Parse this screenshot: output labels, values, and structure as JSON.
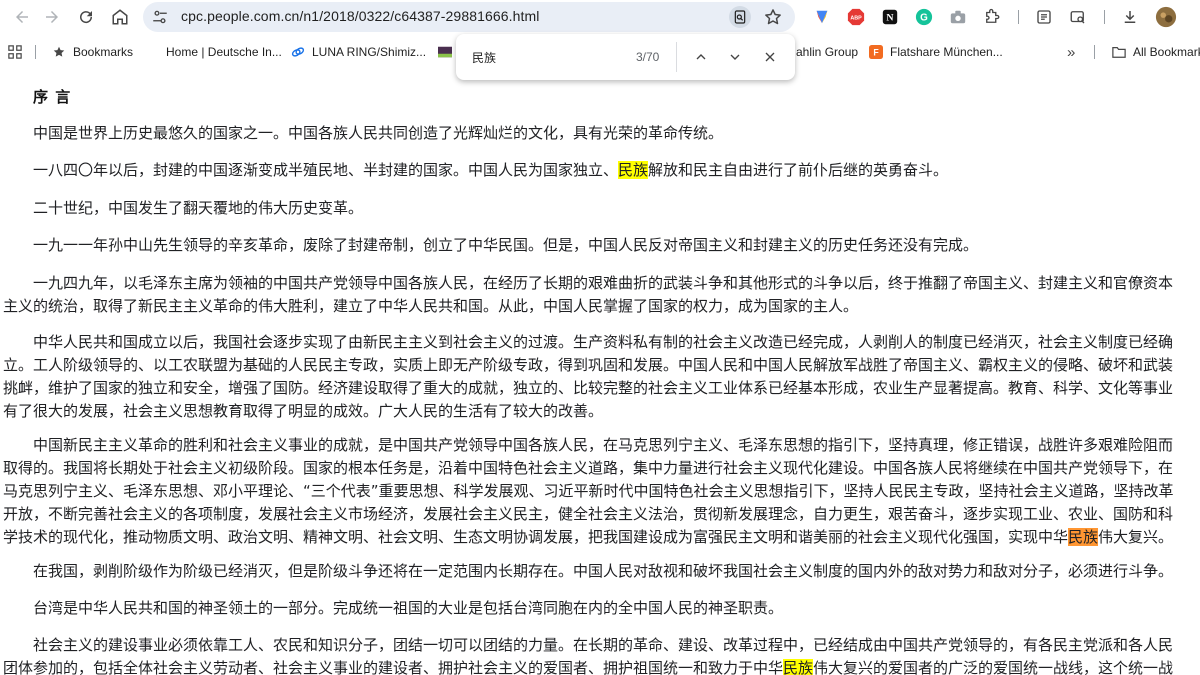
{
  "browser": {
    "url": "cpc.people.com.cn/n1/2018/0322/c64387-29881666.html"
  },
  "bookmarks": {
    "bookmarks_label": "Bookmarks",
    "item_home": "Home | Deutsche In...",
    "item_luna": "LUNA RING/Shimiz...",
    "item_dahlin": "ahlin Group",
    "item_flatshare": "Flatshare München...",
    "overflow": "»",
    "all_bookmarks": "All Bookmark"
  },
  "find": {
    "query": "民族",
    "count": "3/70"
  },
  "article": {
    "heading": "序 言",
    "p1": [
      "中国是世界上历史最悠久的国家之一。中国各族人民共同创造了光辉灿烂的文化，具有光荣的革命传统。"
    ],
    "p2_pre": "一八四〇年以后，封建的中国逐渐变成半殖民地、半封建的国家。中国人民为国家独立、",
    "p2_hl": "民族",
    "p2_post": "解放和民主自由进行了前仆后继的英勇奋斗。",
    "p3": [
      "二十世纪，中国发生了翻天覆地的伟大历史变革。"
    ],
    "p4": [
      "一九一一年孙中山先生领导的辛亥革命，废除了封建帝制，创立了中华民国。但是，中国人民反对帝国主义和封建主义的历史任务还没有完成。"
    ],
    "p5": [
      "一九四九年，以毛泽东主席为领袖的中国共产党领导中国各族人民，在经历了长期的艰难曲折的武装斗争和其他形式的斗争以后，终于推翻了帝国主义、封建主义和官僚资本",
      "主义的统治，取得了新民主主义革命的伟大胜利，建立了中华人民共和国。从此，中国人民掌握了国家的权力，成为国家的主人。"
    ],
    "p6": [
      "中华人民共和国成立以后，我国社会逐步实现了由新民主主义到社会主义的过渡。生产资料私有制的社会主义改造已经完成，人剥削人的制度已经消灭，社会主义制度已经确",
      "立。工人阶级领导的、以工农联盟为基础的人民民主专政，实质上即无产阶级专政，得到巩固和发展。中国人民和中国人民解放军战胜了帝国主义、霸权主义的侵略、破坏和武装",
      "挑衅，维护了国家的独立和安全，增强了国防。经济建设取得了重大的成就，独立的、比较完整的社会主义工业体系已经基本形成，农业生产显著提高。教育、科学、文化等事业",
      "有了很大的发展，社会主义思想教育取得了明显的成效。广大人民的生活有了较大的改善。"
    ],
    "p7": [
      "中国新民主主义革命的胜利和社会主义事业的成就，是中国共产党领导中国各族人民，在马克思列宁主义、毛泽东思想的指引下，坚持真理，修正错误，战胜许多艰难险阻而",
      "取得的。我国将长期处于社会主义初级阶段。国家的根本任务是，沿着中国特色社会主义道路，集中力量进行社会主义现代化建设。中国各族人民将继续在中国共产党领导下，在",
      "马克思列宁主义、毛泽东思想、邓小平理论、“三个代表”重要思想、科学发展观、习近平新时代中国特色社会主义思想指引下，坚持人民民主专政，坚持社会主义道路，坚持改革",
      "开放，不断完善社会主义的各项制度，发展社会主义市场经济，发展社会主义民主，健全社会主义法治，贯彻新发展理念，自力更生，艰苦奋斗，逐步实现工业、农业、国防和科"
    ],
    "p7_last_pre": "学技术的现代化，推动物质文明、政治文明、精神文明、社会文明、生态文明协调发展，把我国建设成为富强民主文明和谐美丽的社会主义现代化强国，实现中华",
    "p7_last_hl": "民族",
    "p7_last_post": "伟大复兴。",
    "p8": [
      "在我国，剥削阶级作为阶级已经消灭，但是阶级斗争还将在一定范围内长期存在。中国人民对敌视和破坏我国社会主义制度的国内外的敌对势力和敌对分子，必须进行斗争。"
    ],
    "p9": [
      "台湾是中华人民共和国的神圣领土的一部分。完成统一祖国的大业是包括台湾同胞在内的全中国人民的神圣职责。"
    ],
    "p10_l1": "社会主义的建设事业必须依靠工人、农民和知识分子，团结一切可以团结的力量。在长期的革命、建设、改革过程中，已经结成由中国共产党领导的，有各民主党派和各人民",
    "p10_l2_pre": "团体参加的，包括全体社会主义劳动者、社会主义事业的建设者、拥护社会主义的爱国者、拥护祖国统一和致力于中华",
    "p10_l2_hl": "民族",
    "p10_l2_post": "伟大复兴的爱国者的广泛的爱国统一战线，这个统一战"
  },
  "colors": {
    "highlight": "#ffff00",
    "active_highlight": "#ff9632"
  }
}
